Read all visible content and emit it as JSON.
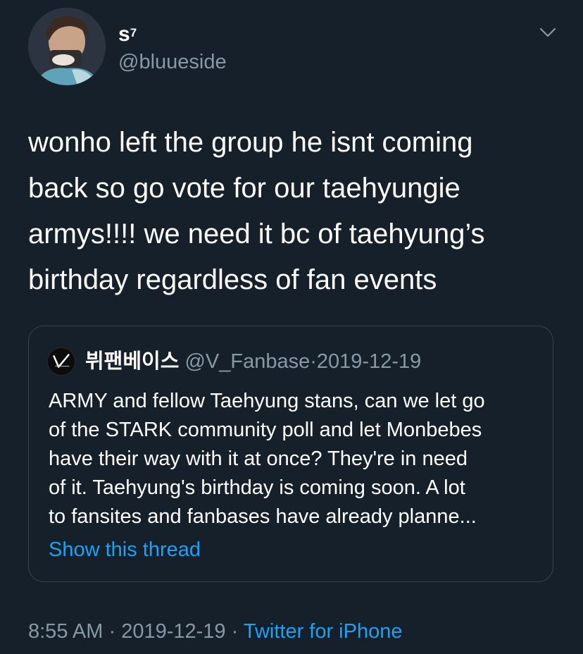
{
  "author": {
    "display_name": "s",
    "display_name_sup": "7",
    "handle": "@bluueside"
  },
  "icons": {
    "menu": "chevron-down-icon",
    "avatar": "user-avatar",
    "quote_avatar": "fanbase-logo"
  },
  "tweet": {
    "text": "wonho left the group he isnt coming\nback so go vote for our taehyungie\narmys!!!! we need it bc of taehyung’s\nbirthday regardless of fan events"
  },
  "quoted_tweet": {
    "display_name": "뷔팬베이스",
    "handle": "@V_Fanbase",
    "separator": "·",
    "date": "2019-12-19",
    "text": "ARMY and fellow Taehyung stans, can we let go\nof the STARK community poll and let Monbebes\nhave their way with it at once? They're in need\nof it. Taehyung's birthday is coming soon. A lot\nto fansites and fanbases have already planne...",
    "show_thread": "Show this thread"
  },
  "footer": {
    "time": "8:55 AM",
    "sep1": "·",
    "date": "2019-12-19",
    "sep2": "·",
    "source": "Twitter for iPhone"
  },
  "colors": {
    "background": "#15202b",
    "secondary_text": "#8899a6",
    "link": "#1da1f2",
    "border": "#38444d"
  }
}
